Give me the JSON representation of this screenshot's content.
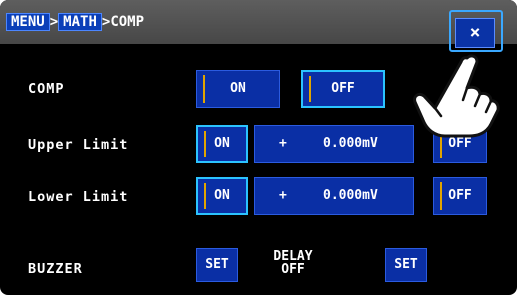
{
  "breadcrumb": {
    "menu": "MENU",
    "sep1": ">",
    "math": "MATH",
    "sep2": ">",
    "current": "COMP"
  },
  "close_label": "×",
  "comp": {
    "label": "COMP",
    "on": "ON",
    "off": "OFF"
  },
  "upper": {
    "label": "Upper Limit",
    "on": "ON",
    "sign": "+",
    "value": "0.000mV",
    "off": "OFF"
  },
  "lower": {
    "label": "Lower Limit",
    "on": "ON",
    "sign": "+",
    "value": "0.000mV",
    "off": "OFF"
  },
  "buzzer": {
    "label": "BUZZER",
    "set": "SET",
    "delay_line1": "DELAY",
    "delay_line2": "OFF",
    "delay_set": "SET"
  },
  "colors": {
    "accent": "#0a2fa5",
    "highlight": "#2bc3ff",
    "indicator": "#e0a400"
  },
  "icons": {
    "close": "close-icon",
    "pointer": "pointing-hand-icon"
  }
}
